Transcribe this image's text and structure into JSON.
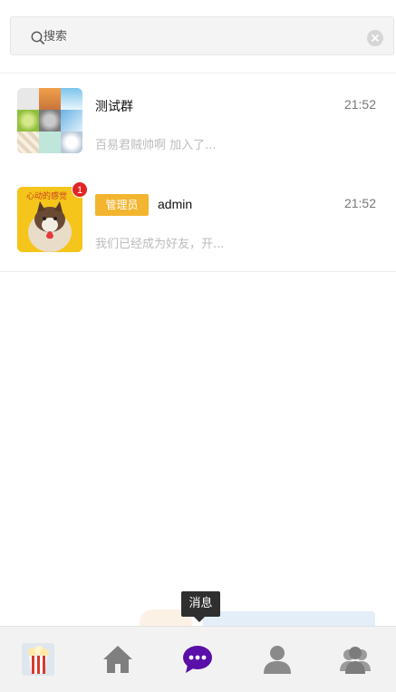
{
  "search": {
    "placeholder": "搜索",
    "value": ""
  },
  "conversations": [
    {
      "name": "测试群",
      "time": "21:52",
      "preview": "百易君贼帅啊 加入了..."
    },
    {
      "role": "管理员",
      "name": "admin",
      "time": "21:52",
      "preview": "我们已经成为好友，开...",
      "unread": "1"
    }
  ],
  "tooltip": {
    "text": "消息"
  },
  "tabbar": {
    "items": [
      {
        "icon": "popcorn-icon"
      },
      {
        "icon": "home-icon"
      },
      {
        "icon": "message-icon",
        "active": true,
        "color": "#5a0fa8"
      },
      {
        "icon": "contact-icon"
      },
      {
        "icon": "group-icon"
      }
    ]
  },
  "colors": {
    "accent": "#5a0fa8",
    "role_badge": "#f3b52f",
    "unread": "#e22424"
  }
}
